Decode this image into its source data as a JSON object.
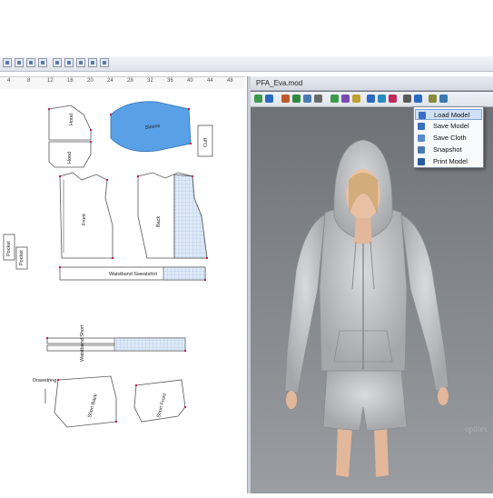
{
  "viewer": {
    "title": "PFA_Eva.mod",
    "watermark": "optitex"
  },
  "ruler": {
    "ticks": [
      "4",
      "8",
      "12",
      "16",
      "20",
      "24",
      "28",
      "32",
      "36",
      "40",
      "44",
      "48"
    ]
  },
  "context_menu": {
    "items": [
      {
        "label": "Load Model",
        "icon": "load-model-icon",
        "active": true
      },
      {
        "label": "Save Model",
        "icon": "save-model-icon",
        "active": false
      },
      {
        "label": "Save Cloth",
        "icon": "save-cloth-icon",
        "active": false
      },
      {
        "label": "Snapshot",
        "icon": "snapshot-icon",
        "active": false
      },
      {
        "label": "Print Model",
        "icon": "print-model-icon",
        "active": false
      }
    ]
  },
  "pattern_pieces": {
    "hood_top": "Hood",
    "hood_bottom": "Hood",
    "sleeve": "Sleeve",
    "cuff": "Cuff",
    "front": "Front",
    "back": "Back",
    "pocket_left": "Pocket",
    "pocket_right": "Pocket",
    "waistband_sweatshirt": "Waistband Sweatshirt",
    "waistband_short": "Waistband Short",
    "drawstring": "Drawstring",
    "short_back": "Short Back",
    "short_front": "Short Front"
  },
  "colors": {
    "sleeve_fill": "#5aa0e6",
    "grid_fill": "#d7e6f7",
    "point_marker": "#c0195a",
    "viewer_bg": "#7a7d82",
    "menu_highlight": "#cfe0f7"
  }
}
